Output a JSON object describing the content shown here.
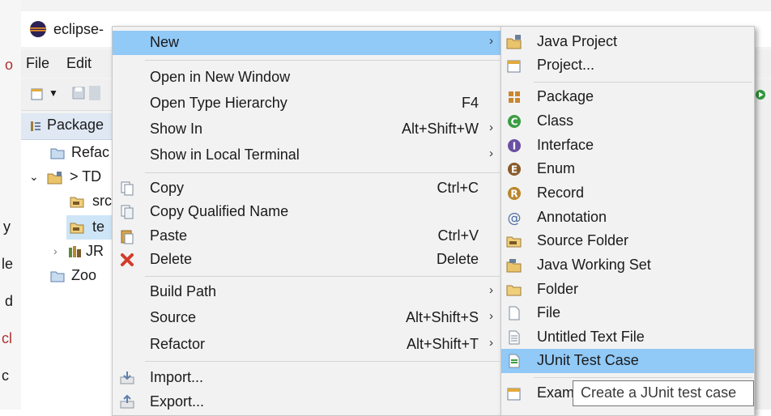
{
  "window": {
    "title": "eclipse-",
    "menubar": [
      "File",
      "Edit"
    ],
    "panel_tab": "Package",
    "tree": [
      {
        "label": "Refac"
      },
      {
        "label": "> TD"
      },
      {
        "label": "src"
      },
      {
        "label": "te"
      },
      {
        "label": "JR"
      },
      {
        "label": "Zoo"
      }
    ],
    "left_edge_letters": [
      "o",
      "y",
      "le",
      "d",
      "cl",
      "c"
    ]
  },
  "context_menu": {
    "items": [
      {
        "label": "New",
        "shortcut": "",
        "submenu": true
      },
      {
        "label": "Open in New Window",
        "shortcut": ""
      },
      {
        "label": "Open Type Hierarchy",
        "shortcut": "F4"
      },
      {
        "label": "Show In",
        "shortcut": "Alt+Shift+W",
        "submenu": true
      },
      {
        "label": "Show in Local Terminal",
        "shortcut": "",
        "submenu": true
      },
      {
        "label": "Copy",
        "shortcut": "Ctrl+C"
      },
      {
        "label": "Copy Qualified Name",
        "shortcut": ""
      },
      {
        "label": "Paste",
        "shortcut": "Ctrl+V"
      },
      {
        "label": "Delete",
        "shortcut": "Delete"
      },
      {
        "label": "Build Path",
        "shortcut": "",
        "submenu": true
      },
      {
        "label": "Source",
        "shortcut": "Alt+Shift+S",
        "submenu": true
      },
      {
        "label": "Refactor",
        "shortcut": "Alt+Shift+T",
        "submenu": true
      },
      {
        "label": "Import...",
        "shortcut": ""
      },
      {
        "label": "Export...",
        "shortcut": ""
      }
    ]
  },
  "new_submenu": {
    "items": [
      {
        "label": "Java Project",
        "icon": "java-project-icon"
      },
      {
        "label": "Project...",
        "icon": "project-icon"
      },
      {
        "label": "Package",
        "icon": "package-icon"
      },
      {
        "label": "Class",
        "icon": "class-icon"
      },
      {
        "label": "Interface",
        "icon": "interface-icon"
      },
      {
        "label": "Enum",
        "icon": "enum-icon"
      },
      {
        "label": "Record",
        "icon": "record-icon"
      },
      {
        "label": "Annotation",
        "icon": "annotation-icon"
      },
      {
        "label": "Source Folder",
        "icon": "source-folder-icon"
      },
      {
        "label": "Java Working Set",
        "icon": "working-set-icon"
      },
      {
        "label": "Folder",
        "icon": "folder-icon"
      },
      {
        "label": "File",
        "icon": "file-icon"
      },
      {
        "label": "Untitled Text File",
        "icon": "text-file-icon"
      },
      {
        "label": "JUnit Test Case",
        "icon": "junit-icon"
      },
      {
        "label": "Exam",
        "icon": "example-icon"
      }
    ]
  },
  "tooltip": {
    "text": "Create a JUnit test case"
  },
  "colors": {
    "highlight": "#91c9f7",
    "menu_bg": "#f2f2f2"
  }
}
